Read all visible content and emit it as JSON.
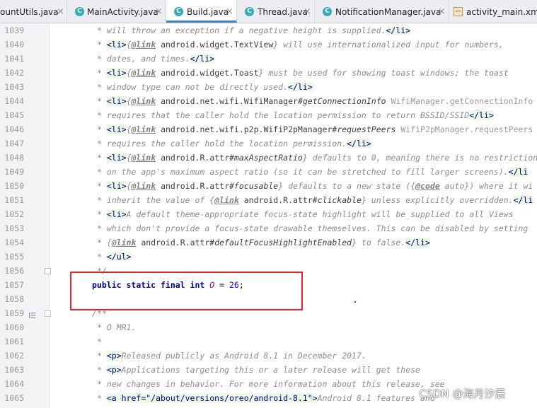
{
  "tabs": [
    {
      "label": "ountUtils.java",
      "icon": "none",
      "active": false,
      "closable": true
    },
    {
      "label": "MainActivity.java",
      "icon": "class-icon",
      "active": false,
      "closable": true
    },
    {
      "label": "Build.java",
      "icon": "class-icon",
      "active": true,
      "closable": true
    },
    {
      "label": "Thread.java",
      "icon": "class-icon",
      "active": false,
      "closable": true
    },
    {
      "label": "NotificationManager.java",
      "icon": "class-icon",
      "active": false,
      "closable": true
    },
    {
      "label": "activity_main.xml",
      "icon": "xml-icon",
      "active": false,
      "closable": false
    }
  ],
  "tab_close_glyph": "×",
  "class_icon_glyph": "C",
  "xml_icon_glyph": "<>",
  "line_numbers": [
    "1039",
    "1040",
    "1041",
    "1042",
    "1043",
    "1044",
    "1045",
    "1046",
    "1047",
    "1048",
    "1049",
    "1050",
    "1051",
    "1052",
    "1053",
    "1054",
    "1055",
    "1056",
    "1057",
    "1058",
    "1059",
    "1060",
    "1061",
    "1062",
    "1063",
    "1064",
    "1065"
  ],
  "code": {
    "l1039": [
      "* will throw an exception if a negative height is supplied.",
      "</li>"
    ],
    "l1040": [
      "* ",
      "<li>",
      "{",
      "@link",
      " ",
      "android.widget.TextView",
      "}",
      " will use internationalized input for numbers,"
    ],
    "l1041": [
      "* dates, and times.",
      "</li>"
    ],
    "l1042": [
      "* ",
      "<li>",
      "{",
      "@link",
      " ",
      "android.widget.Toast",
      "}",
      " must be used for showing toast windows; the toast"
    ],
    "l1043": [
      "* window type can not be directly used.",
      "</li>"
    ],
    "l1044": [
      "* ",
      "<li>",
      "{",
      "@link",
      " ",
      "android.net.wifi.WifiManager",
      "#getConnectionInfo",
      " ",
      "WifiManager.getConnectionInfo"
    ],
    "l1045": [
      "* requires that the caller hold the location permission to return BSSID/SSID",
      "</li>"
    ],
    "l1046": [
      "* ",
      "<li>",
      "{",
      "@link",
      " ",
      "android.net.wifi.p2p.WifiP2pManager",
      "#requestPeers",
      " ",
      "WifiP2pManager.requestPeers"
    ],
    "l1047": [
      "* requires the caller hold the location permission.",
      "</li>"
    ],
    "l1048": [
      "* ",
      "<li>",
      "{",
      "@link",
      " ",
      "android.R.attr",
      "#maxAspectRatio",
      "}",
      " defaults to 0, meaning there is no restriction"
    ],
    "l1049": [
      "* on the app's maximum aspect ratio (so it can be stretched to fill larger screens).",
      "</li"
    ],
    "l1050": [
      "* ",
      "<li>",
      "{",
      "@link",
      " ",
      "android.R.attr",
      "#focusable",
      "}",
      " defaults to a new state ({",
      "@code",
      " auto}) where it wi"
    ],
    "l1051": [
      "* inherit the value of {",
      "@link",
      " ",
      "android.R.attr",
      "#clickable",
      "}",
      " unless explicitly overridden.",
      "</li"
    ],
    "l1052": [
      "* ",
      "<li>",
      "A default theme-appropriate focus-state highlight will be supplied to all Views"
    ],
    "l1053": [
      "* which don't provide a focus-state drawable themselves. This can be disabled by setting"
    ],
    "l1054": [
      "* {",
      "@link",
      " ",
      "android.R.attr",
      "#defaultFocusHighlightEnabled",
      "}",
      " to false.",
      "</li>"
    ],
    "l1055": [
      "* ",
      "</ul>"
    ],
    "l1056": [
      "*/"
    ],
    "l1057": [
      "public",
      " ",
      "static",
      " ",
      "final",
      " ",
      "int",
      " ",
      "O",
      " = ",
      "26",
      ";"
    ],
    "l1058": [
      ""
    ],
    "l1059": [
      "/**"
    ],
    "l1060": [
      "* O MR1."
    ],
    "l1061": [
      "*"
    ],
    "l1062": [
      "* ",
      "<p>",
      "Released publicly as Android 8.1 in December 2017."
    ],
    "l1063": [
      "* ",
      "<p>",
      "Applications targeting this or a later release will get these"
    ],
    "l1064": [
      "* new changes in behavior. For more information about this release, see"
    ],
    "l1065": [
      "* ",
      "<a href=\"/about/versions/oreo/android-8.1\">",
      "Android 8.1 features and"
    ]
  },
  "watermark": "CSDN @海月汐辰",
  "colors": {
    "highlight_box": "#e0262b",
    "active_tab_underline": "#4083c9",
    "javadoc_tag_bg": "#ecf8e6"
  }
}
